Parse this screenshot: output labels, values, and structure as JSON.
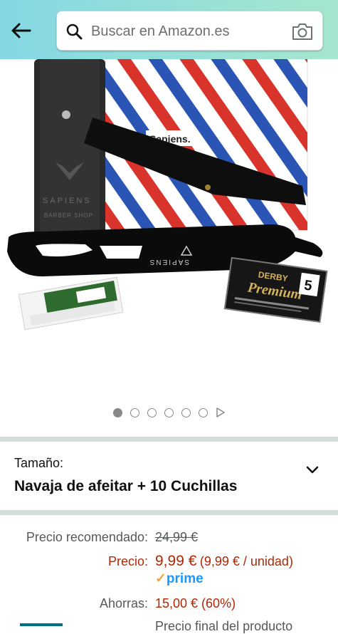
{
  "search": {
    "placeholder": "Buscar en Amazon.es"
  },
  "product_image": {
    "box_brand": "Sapiens.",
    "razor_brand": "SAPIENS",
    "case_brand_line1": "SAPIENS",
    "case_brand_line2": "BARBER SHOP",
    "blade_box_brand": "DERBY",
    "blade_box_name": "Premium",
    "blade_box_count": "5"
  },
  "carousel": {
    "dot_count": 6,
    "active_index": 0
  },
  "size": {
    "label": "Tamaño:",
    "value": "Navaja de afeitar + 10 Cuchillas"
  },
  "pricing": {
    "list_price_label": "Precio recomendado:",
    "list_price": "24,99 €",
    "price_label": "Precio:",
    "price": "9,99 €",
    "unit_price": "(9,99 € / unidad)",
    "prime_label": "prime",
    "savings_label": "Ahorras:",
    "savings": "15,00 € (60%)",
    "cutoff_note": "Precio final del producto"
  },
  "colors": {
    "price_red": "#b12704",
    "prime_blue": "#1a98ff",
    "header_start": "#84d8e3",
    "header_end": "#a6e6ce"
  }
}
